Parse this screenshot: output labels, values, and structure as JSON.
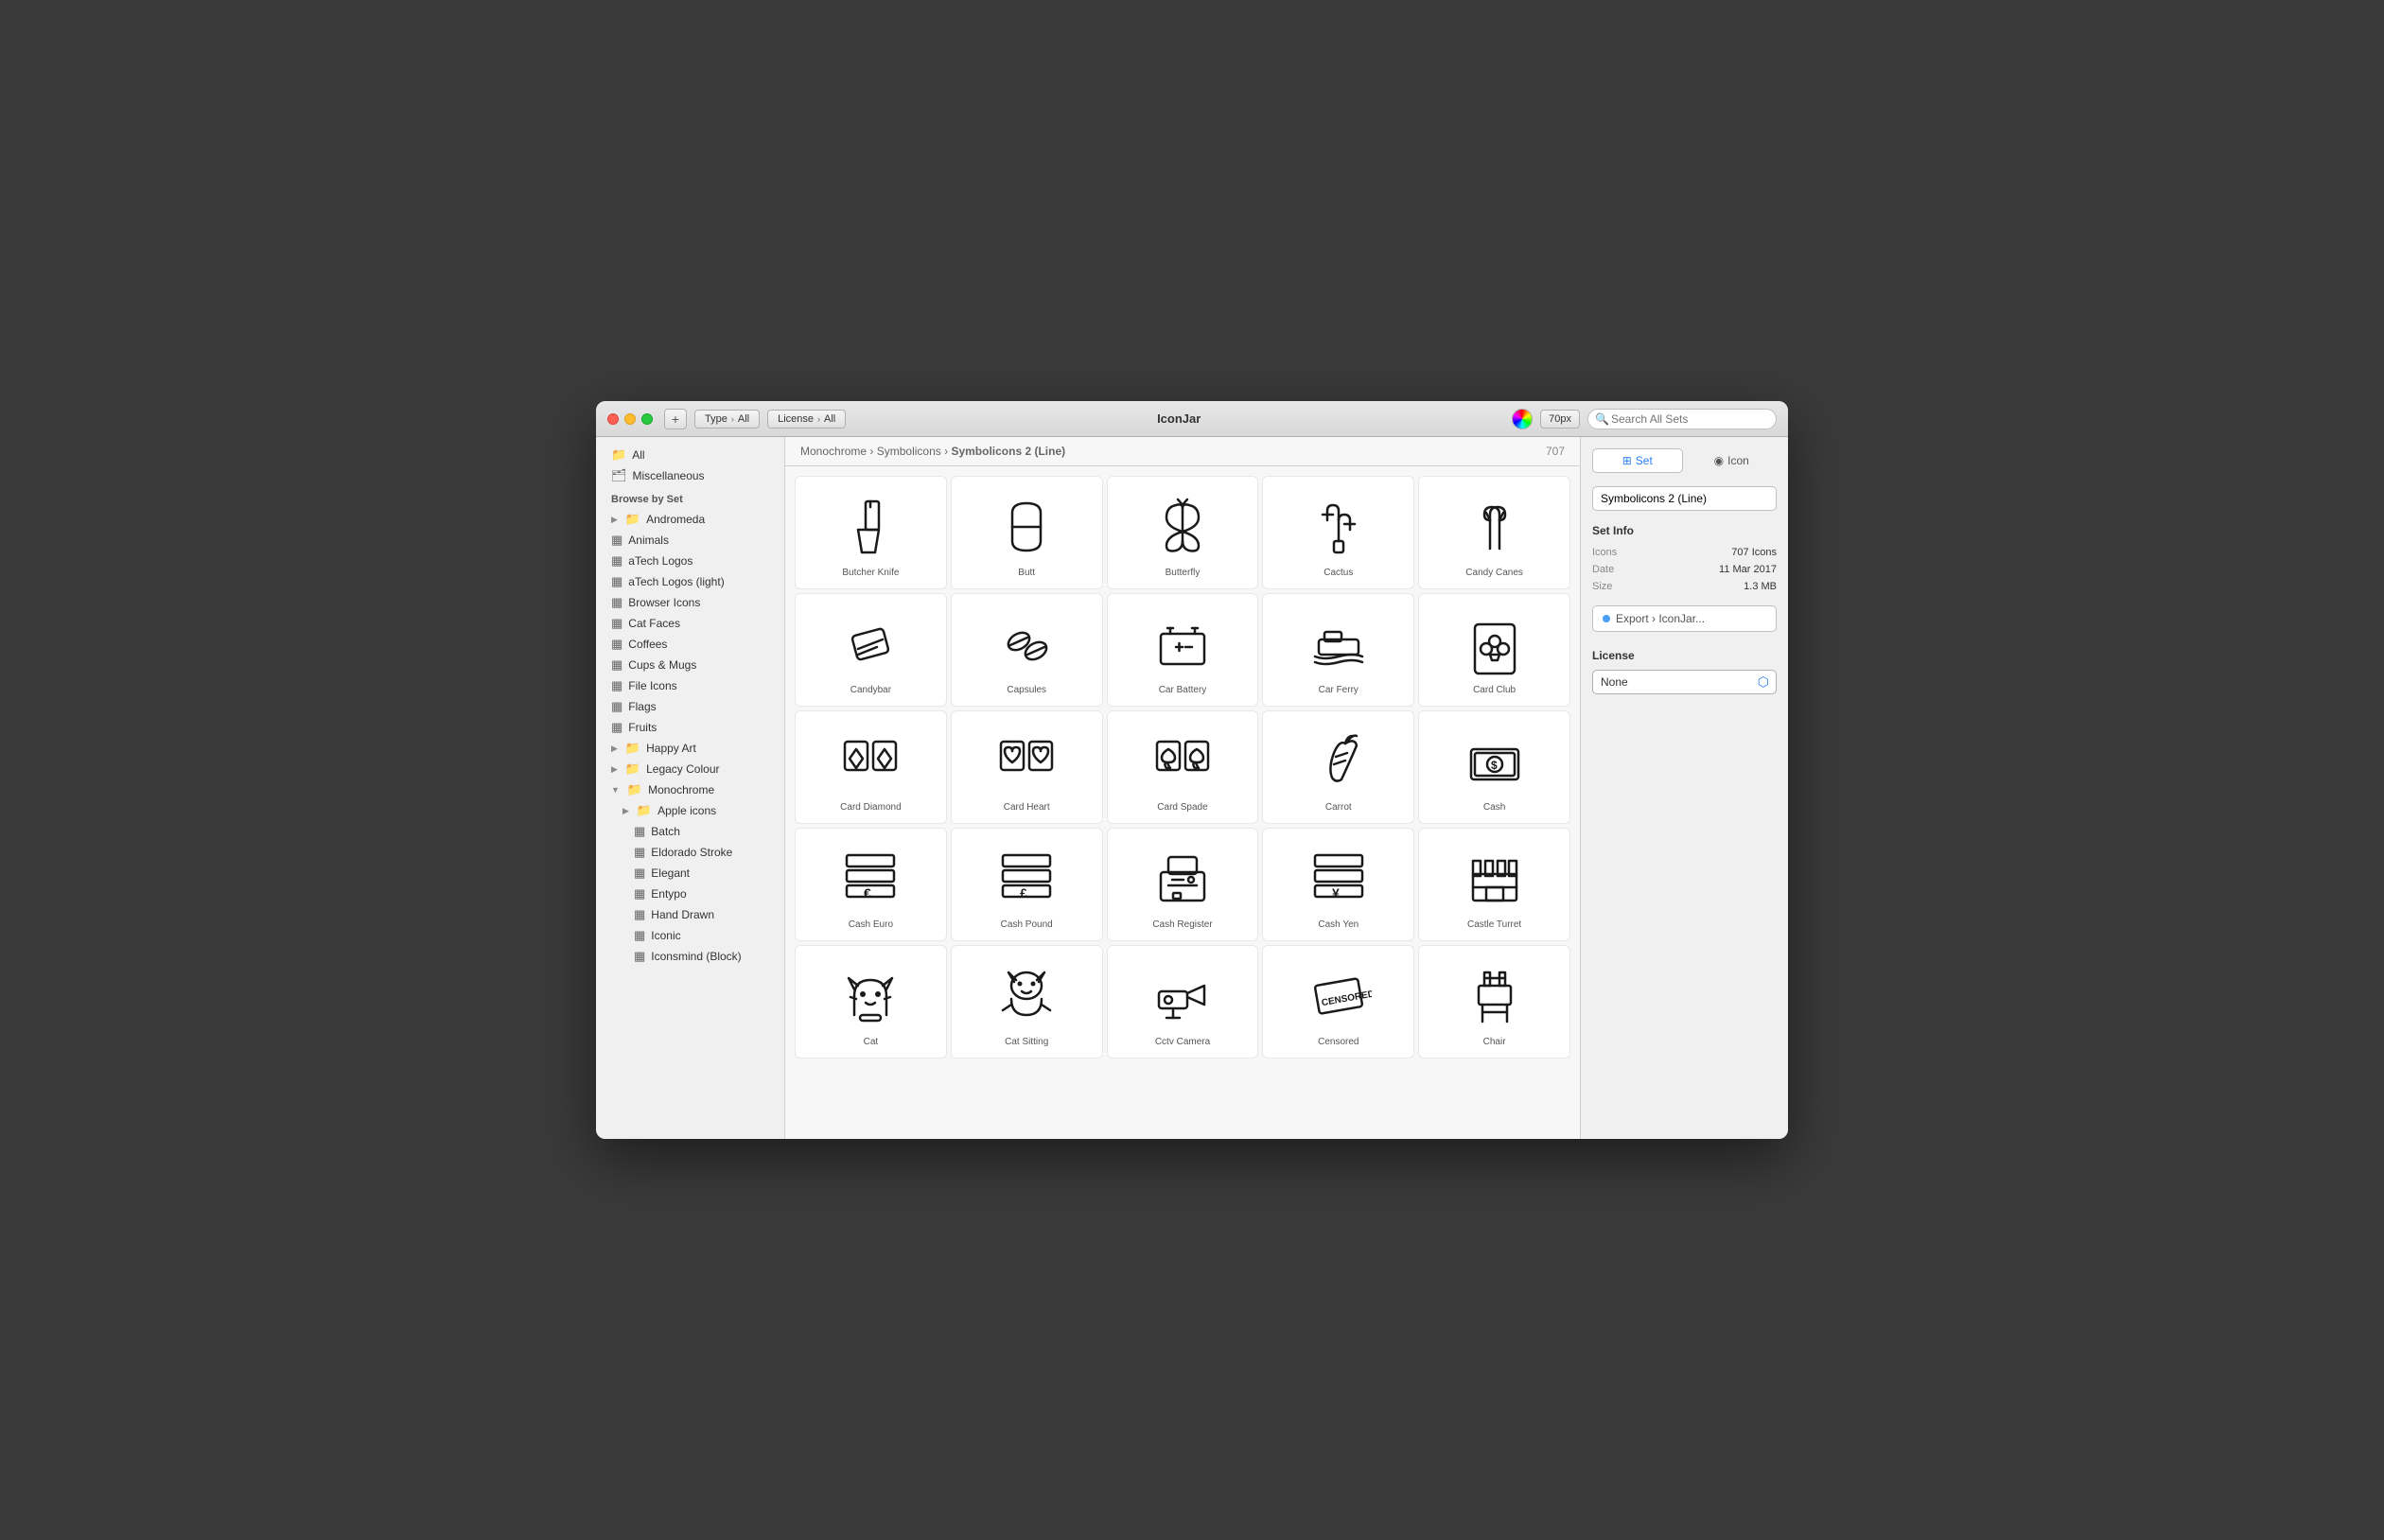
{
  "window": {
    "title": "IconJar"
  },
  "titlebar": {
    "type_btn": "Type",
    "type_val": "All",
    "license_btn": "License",
    "license_val": "All",
    "plus_label": "+",
    "px_label": "70px",
    "search_placeholder": "Search All Sets"
  },
  "breadcrumb": {
    "path1": "Monochrome",
    "path2": "Symbolicons",
    "path3": "Symbolicons 2 (Line)",
    "count": "707"
  },
  "sidebar": {
    "items": [
      {
        "label": "All",
        "type": "root",
        "icon": "folder"
      },
      {
        "label": "Miscellaneous",
        "type": "item",
        "icon": "folder"
      },
      {
        "label": "Browse by Set",
        "type": "section"
      },
      {
        "label": "Andromeda",
        "type": "expandable",
        "icon": "folder"
      },
      {
        "label": "Animals",
        "type": "item",
        "icon": "set"
      },
      {
        "label": "aTech Logos",
        "type": "item",
        "icon": "set"
      },
      {
        "label": "aTech Logos (light)",
        "type": "item",
        "icon": "set"
      },
      {
        "label": "Browser Icons",
        "type": "item",
        "icon": "set"
      },
      {
        "label": "Cat Faces",
        "type": "item",
        "icon": "set"
      },
      {
        "label": "Coffees",
        "type": "item",
        "icon": "set"
      },
      {
        "label": "Cups & Mugs",
        "type": "item",
        "icon": "set"
      },
      {
        "label": "File Icons",
        "type": "item",
        "icon": "set"
      },
      {
        "label": "Flags",
        "type": "item",
        "icon": "set"
      },
      {
        "label": "Fruits",
        "type": "item",
        "icon": "set"
      },
      {
        "label": "Happy Art",
        "type": "expandable",
        "icon": "folder"
      },
      {
        "label": "Legacy Colour",
        "type": "expandable",
        "icon": "folder"
      },
      {
        "label": "Monochrome",
        "type": "expandable-open",
        "icon": "folder"
      },
      {
        "label": "Apple icons",
        "type": "expandable-sub",
        "icon": "folder"
      },
      {
        "label": "Batch",
        "type": "sub-item",
        "icon": "set"
      },
      {
        "label": "Eldorado Stroke",
        "type": "sub-item",
        "icon": "set"
      },
      {
        "label": "Elegant",
        "type": "sub-item",
        "icon": "set"
      },
      {
        "label": "Entypo",
        "type": "sub-item",
        "icon": "set"
      },
      {
        "label": "Hand Drawn",
        "type": "sub-item",
        "icon": "set"
      },
      {
        "label": "Iconic",
        "type": "sub-item",
        "icon": "set"
      },
      {
        "label": "Iconsmind (Block)",
        "type": "sub-item",
        "icon": "set"
      }
    ]
  },
  "icons": [
    {
      "name": "Butcher Knife",
      "svg": "butcher-knife"
    },
    {
      "name": "Butt",
      "svg": "butt"
    },
    {
      "name": "Butterfly",
      "svg": "butterfly"
    },
    {
      "name": "Cactus",
      "svg": "cactus"
    },
    {
      "name": "Candy Canes",
      "svg": "candy-canes"
    },
    {
      "name": "Candybar",
      "svg": "candybar"
    },
    {
      "name": "Capsules",
      "svg": "capsules"
    },
    {
      "name": "Car Battery",
      "svg": "car-battery"
    },
    {
      "name": "Car Ferry",
      "svg": "car-ferry"
    },
    {
      "name": "Card Club",
      "svg": "card-club"
    },
    {
      "name": "Card Diamond",
      "svg": "card-diamond"
    },
    {
      "name": "Card Heart",
      "svg": "card-heart"
    },
    {
      "name": "Card Spade",
      "svg": "card-spade"
    },
    {
      "name": "Carrot",
      "svg": "carrot"
    },
    {
      "name": "Cash",
      "svg": "cash"
    },
    {
      "name": "Cash Euro",
      "svg": "cash-euro"
    },
    {
      "name": "Cash Pound",
      "svg": "cash-pound"
    },
    {
      "name": "Cash Register",
      "svg": "cash-register"
    },
    {
      "name": "Cash Yen",
      "svg": "cash-yen"
    },
    {
      "name": "Castle Turret",
      "svg": "castle-turret"
    },
    {
      "name": "Cat",
      "svg": "cat"
    },
    {
      "name": "Cat Sitting",
      "svg": "cat-sitting"
    },
    {
      "name": "Cctv Camera",
      "svg": "cctv-camera"
    },
    {
      "name": "Censored",
      "svg": "censored"
    },
    {
      "name": "Chair",
      "svg": "chair"
    }
  ],
  "right_panel": {
    "tab_set": "Set",
    "tab_icon": "Icon",
    "set_name": "Symbolicons 2 (Line)",
    "set_info_title": "Set Info",
    "info_rows": [
      {
        "label": "Icons",
        "value": "707 Icons"
      },
      {
        "label": "Date",
        "value": "11 Mar 2017"
      },
      {
        "label": "Size",
        "value": "1.3 MB"
      }
    ],
    "export_label": "Export › IconJar...",
    "license_title": "License",
    "license_value": "None"
  }
}
